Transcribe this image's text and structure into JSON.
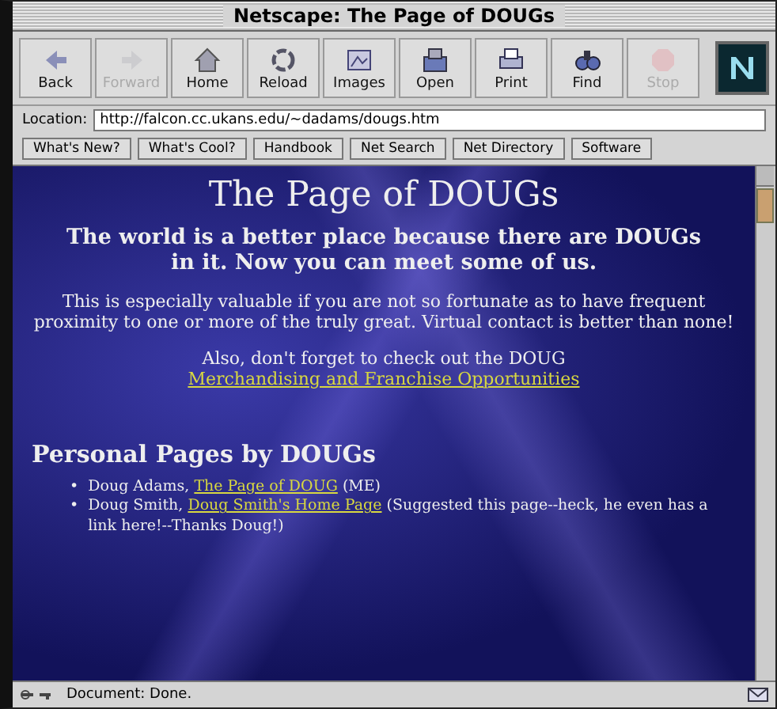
{
  "window": {
    "title": "Netscape: The Page of DOUGs"
  },
  "toolbar": [
    {
      "label": "Back",
      "disabled": false
    },
    {
      "label": "Forward",
      "disabled": true
    },
    {
      "label": "Home",
      "disabled": false
    },
    {
      "label": "Reload",
      "disabled": false
    },
    {
      "label": "Images",
      "disabled": false
    },
    {
      "label": "Open",
      "disabled": false
    },
    {
      "label": "Print",
      "disabled": false
    },
    {
      "label": "Find",
      "disabled": false
    },
    {
      "label": "Stop",
      "disabled": true
    }
  ],
  "location": {
    "label": "Location:",
    "value": "http://falcon.cc.ukans.edu/~dadams/dougs.htm"
  },
  "directory_buttons": [
    "What's New?",
    "What's Cool?",
    "Handbook",
    "Net Search",
    "Net Directory",
    "Software"
  ],
  "page": {
    "heading": "The Page of DOUGs",
    "tagline": "The world is a better place because there are DOUGs in it. Now you can meet some of us.",
    "intro": "This is especially valuable if you are not so fortunate as to have frequent proximity to one or more of the truly great. Virtual contact is better than none!",
    "also": {
      "text": "Also, don't forget to check out the DOUG ",
      "link": "Merchandising and Franchise Opportunities"
    },
    "section_heading": "Personal Pages by DOUGs",
    "entries": [
      {
        "bullet": "•",
        "name": "Doug Adams, ",
        "link": "The Page of DOUG",
        "note": " (ME)"
      },
      {
        "bullet": "•",
        "name": "Doug Smith, ",
        "link": "Doug Smith's Home Page",
        "note": " (Suggested this page--heck, he even has a link here!--Thanks Doug!)"
      }
    ]
  },
  "status_bar": {
    "text": "Document: Done."
  }
}
